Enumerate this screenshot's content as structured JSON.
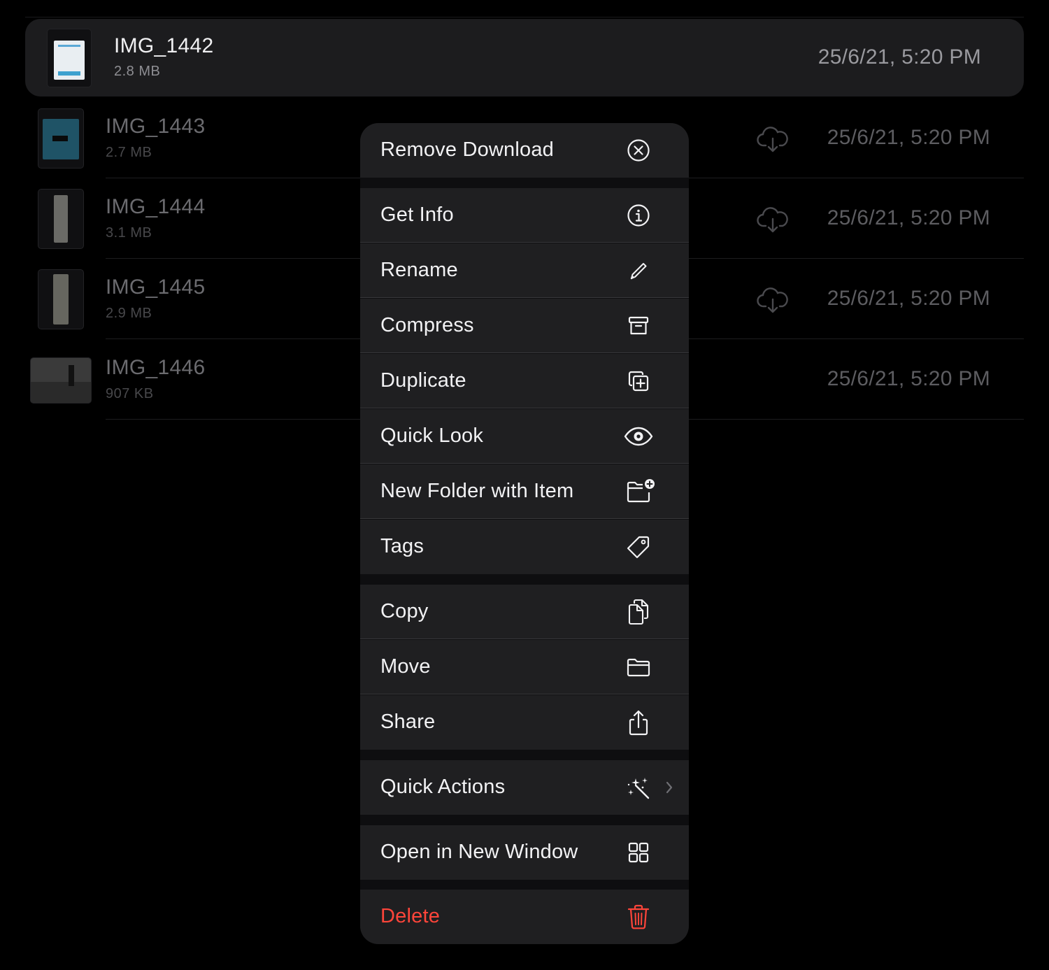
{
  "files": [
    {
      "name": "IMG_1442",
      "size": "2.8 MB",
      "date": "25/6/21, 5:20 PM",
      "selected": true,
      "cloud": false
    },
    {
      "name": "IMG_1443",
      "size": "2.7 MB",
      "date": "25/6/21, 5:20 PM",
      "selected": false,
      "cloud": true
    },
    {
      "name": "IMG_1444",
      "size": "3.1 MB",
      "date": "25/6/21, 5:20 PM",
      "selected": false,
      "cloud": true
    },
    {
      "name": "IMG_1445",
      "size": "2.9 MB",
      "date": "25/6/21, 5:20 PM",
      "selected": false,
      "cloud": true
    },
    {
      "name": "IMG_1446",
      "size": "907 KB",
      "date": "25/6/21, 5:20 PM",
      "selected": false,
      "cloud": false
    }
  ],
  "menu": {
    "remove_download": "Remove Download",
    "get_info": "Get Info",
    "rename": "Rename",
    "compress": "Compress",
    "duplicate": "Duplicate",
    "quick_look": "Quick Look",
    "new_folder_with_item": "New Folder with Item",
    "tags": "Tags",
    "copy": "Copy",
    "move": "Move",
    "share": "Share",
    "quick_actions": "Quick Actions",
    "open_in_new_window": "Open in New Window",
    "delete": "Delete"
  },
  "icons": {
    "remove_download": "xmark-circle-icon",
    "get_info": "info-circle-icon",
    "rename": "pencil-icon",
    "compress": "archive-box-icon",
    "duplicate": "plus-square-on-square-icon",
    "quick_look": "eye-icon",
    "new_folder_with_item": "folder-badge-plus-icon",
    "tags": "tag-icon",
    "copy": "doc-on-doc-icon",
    "move": "folder-icon",
    "share": "square-and-arrow-up-icon",
    "quick_actions": "wand-and-stars-icon",
    "open_in_new_window": "square-grid-2x2-icon",
    "delete": "trash-icon"
  },
  "colors": {
    "background": "#000000",
    "selected_row": "#1c1c1e",
    "menu_item": "#1f1f21",
    "menu_text": "#f2f2f4",
    "danger": "#ff453a"
  }
}
